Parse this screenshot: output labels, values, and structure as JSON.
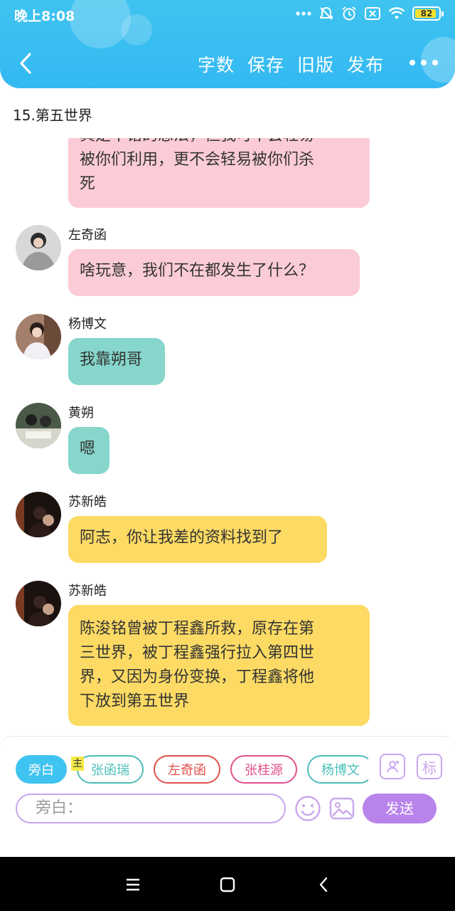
{
  "status_bar": {
    "time": "晚上8:08",
    "battery_level": "82",
    "battery_color": "#f7df2e"
  },
  "header": {
    "accent_color": "#3fc3f0",
    "back_icon": "chevron-left-icon",
    "actions": [
      "字数",
      "保存",
      "旧版",
      "发布"
    ],
    "more_icon": "more-dots-icon"
  },
  "chapter": {
    "title": "15.第五世界"
  },
  "messages": [
    {
      "sender": "",
      "avatar": "none",
      "bubble_color": "pink",
      "lines": [
        "真是不错的想法，但我可不会轻易",
        "被你们利用，更不会轻易被你们杀",
        "死"
      ]
    },
    {
      "sender": "左奇函",
      "avatar": "photo-avatar",
      "bubble_color": "pink",
      "lines": [
        "啥玩意，我们不在都发生了什么？"
      ]
    },
    {
      "sender": "杨博文",
      "avatar": "photo-avatar",
      "bubble_color": "teal",
      "lines": [
        "我靠朔哥"
      ]
    },
    {
      "sender": "黄朔",
      "avatar": "photo-avatar",
      "bubble_color": "teal",
      "lines": [
        "嗯"
      ]
    },
    {
      "sender": "苏新皓",
      "avatar": "photo-avatar",
      "bubble_color": "yellow",
      "lines": [
        "阿志，你让我差的资料找到了"
      ]
    },
    {
      "sender": "苏新皓",
      "avatar": "photo-avatar",
      "bubble_color": "yellow",
      "lines": [
        "陈浚铭曾被丁程鑫所救，原存在第",
        "三世界，被丁程鑫强行拉入第四世",
        "界，又因为身份变换，丁程鑫将他",
        "下放到第五世界"
      ]
    }
  ],
  "compose": {
    "characters": [
      {
        "name": "旁白",
        "active": true,
        "color": "#3fc3f0"
      },
      {
        "name": "张函瑞",
        "active": false,
        "color": "#4bbfb8"
      },
      {
        "name": "左奇函",
        "active": false,
        "color": "#e0504a"
      },
      {
        "name": "张桂源",
        "active": false,
        "color": "#e0508c"
      },
      {
        "name": "杨博文",
        "active": false,
        "color": "#4bbfb8"
      }
    ],
    "main_tag": "主",
    "tag_button_label": "标",
    "input_placeholder": "旁白：",
    "send_label": "发送",
    "accent_color": "#b883ea"
  }
}
